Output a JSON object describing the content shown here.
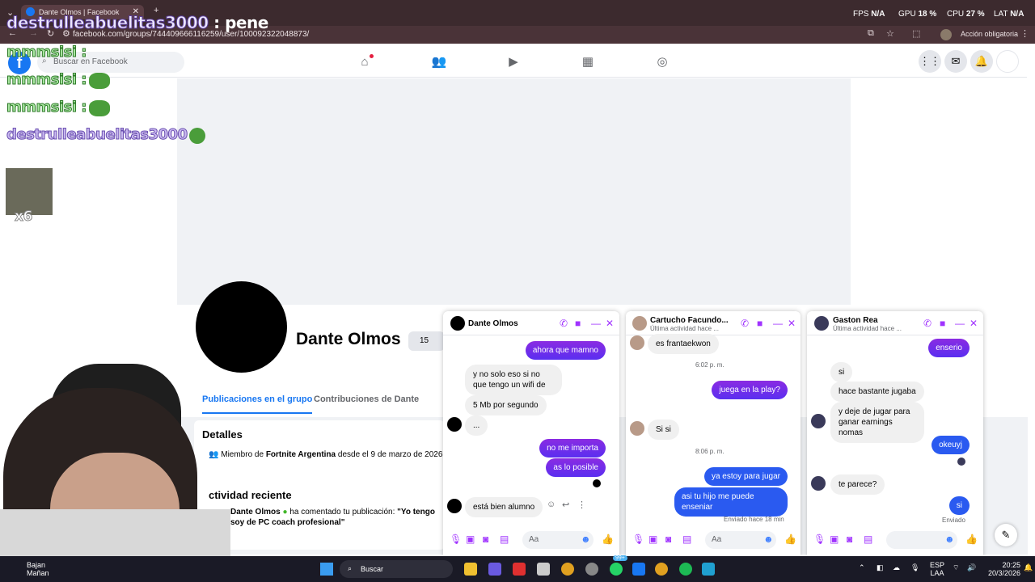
{
  "browser": {
    "tab_title": "Dante Olmos | Facebook",
    "url": "facebook.com/groups/744409666116259/user/100092322048873/",
    "action_label": "Acción obligatoria"
  },
  "perf": {
    "fps_label": "FPS",
    "fps_value": "N/A",
    "gpu_label": "GPU",
    "gpu_value": "18 %",
    "cpu_label": "CPU",
    "cpu_value": "27 %",
    "lat_label": "LAT",
    "lat_value": "N/A"
  },
  "overlay": {
    "top_line_user": "destrulleabuelitas3000",
    "top_line_text": " : pene",
    "line1": "mmmsisi :",
    "line2": "mmmsisi :",
    "line3": "mmmsisi :",
    "line4": "destrulleabuelitas3000 :",
    "multiplier": "x6"
  },
  "facebook": {
    "search_placeholder": "Buscar en Facebook",
    "profile_name": "Dante Olmos",
    "badge_count": "15",
    "tabs": [
      "Publicaciones en el grupo",
      "Contribuciones de Dante"
    ],
    "details_title": "Detalles",
    "member_prefix": "Miembro de ",
    "member_group": "Fortnite Argentina",
    "member_suffix": " desde el 9 de marzo de 2026",
    "activity_title": "ctividad reciente",
    "activity_user": "Dante Olmos",
    "activity_mid": " ha comentado tu publicación: ",
    "activity_quote": "\"Yo tengo soy de PC coach profesional\""
  },
  "chats": [
    {
      "name": "Dante Olmos",
      "subtitle": "",
      "messages": [
        {
          "dir": "out",
          "text": "ahora que mamno"
        },
        {
          "dir": "in",
          "text": "y no solo eso si no que tengo un wifi de"
        },
        {
          "dir": "in",
          "text": "5 Mb por segundo"
        },
        {
          "dir": "in",
          "text": "..."
        },
        {
          "dir": "out",
          "text": "no me importa"
        },
        {
          "dir": "out",
          "text": "as lo posible"
        },
        {
          "dir": "in",
          "text": "está bien alumno"
        }
      ],
      "input_placeholder": "Aa"
    },
    {
      "name": "Cartucho Facundo...",
      "subtitle": "Última actividad hace ...",
      "messages": [
        {
          "dir": "in",
          "text": "es frantaekwon"
        },
        {
          "dir": "time",
          "text": "6:02 p. m."
        },
        {
          "dir": "out",
          "text": "juega en la play?"
        },
        {
          "dir": "in",
          "text": "Si si"
        },
        {
          "dir": "time",
          "text": "8:06 p. m."
        },
        {
          "dir": "out",
          "text": "ya estoy para jugar"
        },
        {
          "dir": "out",
          "text": "asi tu hijo me puede enseniar"
        },
        {
          "dir": "status",
          "text": "Enviado hace 18 min"
        }
      ],
      "input_placeholder": "Aa"
    },
    {
      "name": "Gaston Rea",
      "subtitle": "Última actividad hace ...",
      "messages": [
        {
          "dir": "out",
          "text": "enserio"
        },
        {
          "dir": "in",
          "text": "si"
        },
        {
          "dir": "in",
          "text": "hace bastante jugaba"
        },
        {
          "dir": "in",
          "text": "y deje de jugar para ganar earnings nomas"
        },
        {
          "dir": "out",
          "text": "okeuyj"
        },
        {
          "dir": "in",
          "text": "te parece?"
        },
        {
          "dir": "out",
          "text": "si"
        },
        {
          "dir": "status",
          "text": "Enviado"
        }
      ],
      "input_placeholder": ""
    }
  ],
  "taskbar": {
    "search_label": "Buscar",
    "notif_badge": "99+",
    "weather_line1": "Bajan",
    "weather_line2": "Mañan",
    "lang1": "ESP",
    "lang2": "LAA",
    "time": "20:25",
    "date": "20/3/2026"
  },
  "colors": {
    "fb_blue": "#1877f2",
    "messenger_purple": "#a033ff",
    "chrome_bg": "#3c2a2e"
  }
}
